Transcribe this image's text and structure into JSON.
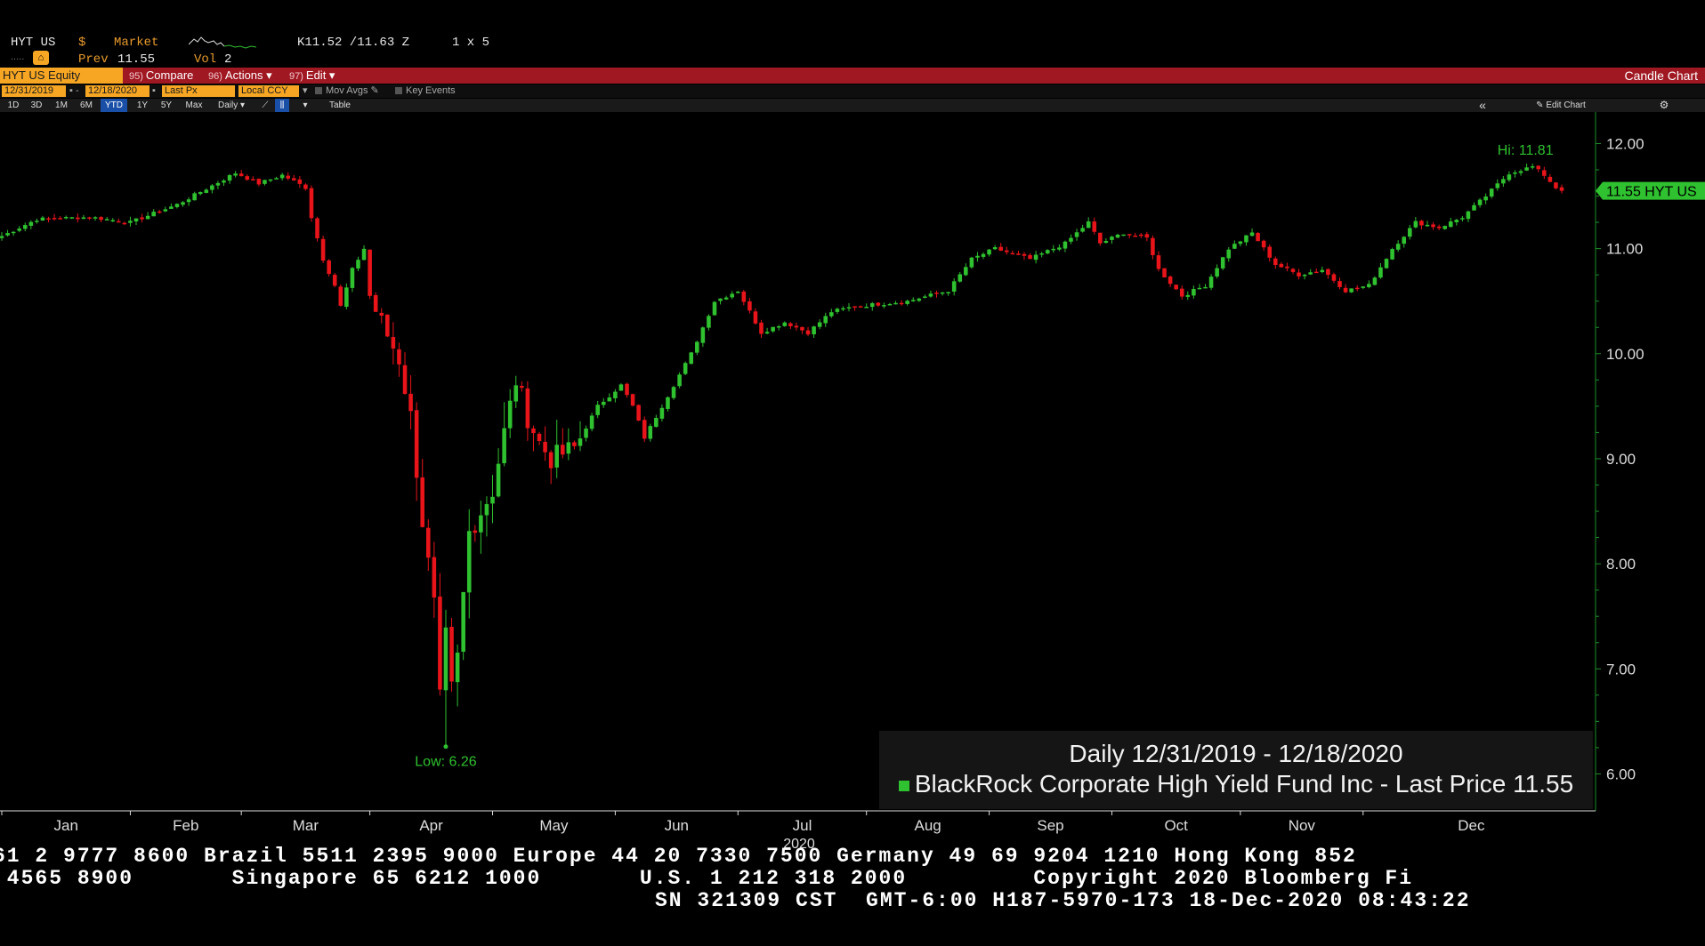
{
  "header": {
    "ticker": "HYT US",
    "currency": "$",
    "market": "Market",
    "bid_ask": "K11.52 /11.63 Z",
    "size": "1 x 5",
    "prev_label": "Prev",
    "prev_value": "11.55",
    "vol_label": "Vol",
    "vol_value": "2"
  },
  "toolbar": {
    "security": "HYT US Equity",
    "compare_num": "95)",
    "compare": "Compare",
    "actions_num": "96)",
    "actions": "Actions ▾",
    "edit_num": "97)",
    "edit": "Edit ▾",
    "chart_type": "Candle Chart",
    "start_date": "12/31/2019",
    "end_date": "12/18/2020",
    "field": "Last Px",
    "ccy": "Local CCY",
    "mov_avgs": "Mov Avgs",
    "key_events": "Key Events",
    "ranges": [
      "1D",
      "3D",
      "1M",
      "6M",
      "YTD",
      "1Y",
      "5Y",
      "Max"
    ],
    "active_range": "YTD",
    "periodicity": "Daily ▾",
    "table": "Table",
    "collapse": "«",
    "edit_chart": "Edit Chart",
    "settings_icon": "gear-icon"
  },
  "colors": {
    "up": "#2fc12f",
    "down": "#e8141a",
    "axis": "#1e8f2a",
    "accent": "#f6a623",
    "bar": "#a01822"
  },
  "chart_data": {
    "type": "candlestick",
    "xlabel": "2020",
    "months": [
      "Jan",
      "Feb",
      "Mar",
      "Apr",
      "May",
      "Jun",
      "Jul",
      "Aug",
      "Sep",
      "Oct",
      "Nov",
      "Dec"
    ],
    "yticks": [
      "6.00",
      "7.00",
      "8.00",
      "9.00",
      "10.00",
      "11.00",
      "12.00"
    ],
    "ylim": [
      5.75,
      12.3
    ],
    "date_range": [
      "2019-12-31",
      "2020-12-18"
    ],
    "hi_label": "Hi: 11.81",
    "hi": 11.81,
    "low_label": "Low: 6.26",
    "low": 6.26,
    "last_price_tag": "11.55 HYT US",
    "last_price": 11.55,
    "legend_title": "Daily 12/31/2019 - 12/18/2020",
    "legend_series": "BlackRock Corporate High Yield Fund Inc - Last Price 11.55",
    "anchors": [
      [
        0,
        11.12
      ],
      [
        6,
        11.28
      ],
      [
        15,
        11.3
      ],
      [
        22,
        11.25
      ],
      [
        30,
        11.42
      ],
      [
        36,
        11.6
      ],
      [
        40,
        11.72
      ],
      [
        44,
        11.62
      ],
      [
        48,
        11.7
      ],
      [
        52,
        11.58
      ],
      [
        53,
        11.3
      ],
      [
        55,
        10.9
      ],
      [
        57,
        10.65
      ],
      [
        58,
        10.45
      ],
      [
        60,
        10.8
      ],
      [
        62,
        11.0
      ],
      [
        63,
        10.55
      ],
      [
        64,
        10.4
      ],
      [
        68,
        9.95
      ],
      [
        70,
        9.4
      ],
      [
        72,
        8.4
      ],
      [
        74,
        7.6
      ],
      [
        75,
        6.7
      ],
      [
        76,
        7.3
      ],
      [
        77,
        6.8
      ],
      [
        78,
        7.1
      ],
      [
        80,
        8.3
      ],
      [
        82,
        8.5
      ],
      [
        84,
        8.7
      ],
      [
        86,
        9.25
      ],
      [
        88,
        9.75
      ],
      [
        90,
        9.4
      ],
      [
        92,
        9.15
      ],
      [
        94,
        9.0
      ],
      [
        98,
        9.1
      ],
      [
        102,
        9.5
      ],
      [
        106,
        9.7
      ],
      [
        108,
        9.5
      ],
      [
        110,
        9.2
      ],
      [
        114,
        9.6
      ],
      [
        118,
        10.0
      ],
      [
        122,
        10.5
      ],
      [
        126,
        10.6
      ],
      [
        130,
        10.2
      ],
      [
        134,
        10.3
      ],
      [
        138,
        10.2
      ],
      [
        142,
        10.4
      ],
      [
        146,
        10.45
      ],
      [
        155,
        10.5
      ],
      [
        162,
        10.6
      ],
      [
        166,
        10.9
      ],
      [
        170,
        11.0
      ],
      [
        176,
        10.9
      ],
      [
        182,
        11.05
      ],
      [
        186,
        11.25
      ],
      [
        188,
        11.05
      ],
      [
        192,
        11.15
      ],
      [
        196,
        11.1
      ],
      [
        198,
        10.8
      ],
      [
        202,
        10.55
      ],
      [
        206,
        10.65
      ],
      [
        210,
        11.0
      ],
      [
        214,
        11.15
      ],
      [
        218,
        10.85
      ],
      [
        222,
        10.75
      ],
      [
        226,
        10.8
      ],
      [
        230,
        10.6
      ],
      [
        234,
        10.65
      ],
      [
        238,
        11.0
      ],
      [
        242,
        11.25
      ],
      [
        246,
        11.2
      ],
      [
        250,
        11.3
      ],
      [
        254,
        11.5
      ],
      [
        258,
        11.72
      ],
      [
        262,
        11.78
      ],
      [
        264,
        11.7
      ],
      [
        266,
        11.58
      ]
    ],
    "ohlc_count": 268
  },
  "footer": {
    "line1": "61 2 9777 8600 Brazil 5511 2395 9000 Europe 44 20 7330 7500 Germany 49 69 9204 1210 Hong Kong 852",
    "line2": " 4565 8900       Singapore 65 6212 1000       U.S. 1 212 318 2000         Copyright 2020 Bloomberg Fi",
    "line3": "SN 321309 CST  GMT-6:00 H187-5970-173 18-Dec-2020 08:43:22"
  }
}
